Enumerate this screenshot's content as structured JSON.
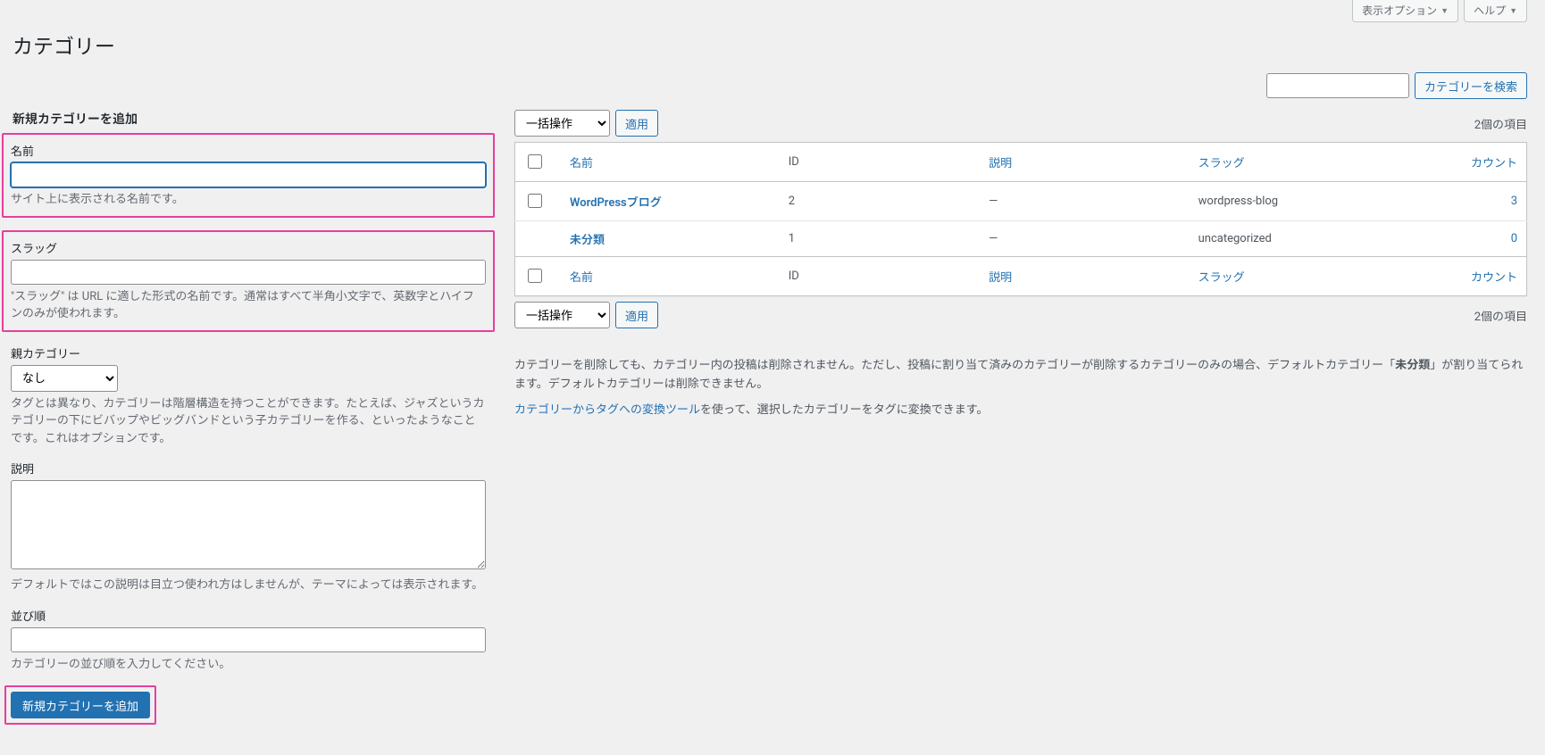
{
  "screen_options_label": "表示オプション",
  "help_label": "ヘルプ",
  "page_title": "カテゴリー",
  "search": {
    "value": "",
    "button": "カテゴリーを検索"
  },
  "form": {
    "heading": "新規カテゴリーを追加",
    "name": {
      "label": "名前",
      "value": "",
      "desc": "サイト上に表示される名前です。"
    },
    "slug": {
      "label": "スラッグ",
      "value": "",
      "desc": "\"スラッグ\" は URL に適した形式の名前です。通常はすべて半角小文字で、英数字とハイフンのみが使われます。"
    },
    "parent": {
      "label": "親カテゴリー",
      "selected": "なし",
      "desc": "タグとは異なり、カテゴリーは階層構造を持つことができます。たとえば、ジャズというカテゴリーの下にビバップやビッグバンドという子カテゴリーを作る、といったようなことです。これはオプションです。"
    },
    "description": {
      "label": "説明",
      "value": "",
      "desc": "デフォルトではこの説明は目立つ使われ方はしませんが、テーマによっては表示されます。"
    },
    "order": {
      "label": "並び順",
      "value": "",
      "desc": "カテゴリーの並び順を入力してください。"
    },
    "submit": "新規カテゴリーを追加"
  },
  "bulk": {
    "select": "一括操作",
    "apply": "適用"
  },
  "item_count": "2個の項目",
  "columns": {
    "name": "名前",
    "id": "ID",
    "description": "説明",
    "slug": "スラッグ",
    "count": "カウント"
  },
  "rows": [
    {
      "name": "WordPressブログ",
      "id": "2",
      "desc": "—",
      "slug": "wordpress-blog",
      "count": "3"
    },
    {
      "name": "未分類",
      "id": "1",
      "desc": "—",
      "slug": "uncategorized",
      "count": "0"
    }
  ],
  "footer": {
    "note1_a": "カテゴリーを削除しても、カテゴリー内の投稿は削除されません。ただし、投稿に割り当て済みのカテゴリーが削除するカテゴリーのみの場合、デフォルトカテゴリー「",
    "note1_strong": "未分類",
    "note1_b": "」が割り当てられます。デフォルトカテゴリーは削除できません。",
    "link": "カテゴリーからタグへの変換ツール",
    "note2_b": "を使って、選択したカテゴリーをタグに変換できます。"
  }
}
